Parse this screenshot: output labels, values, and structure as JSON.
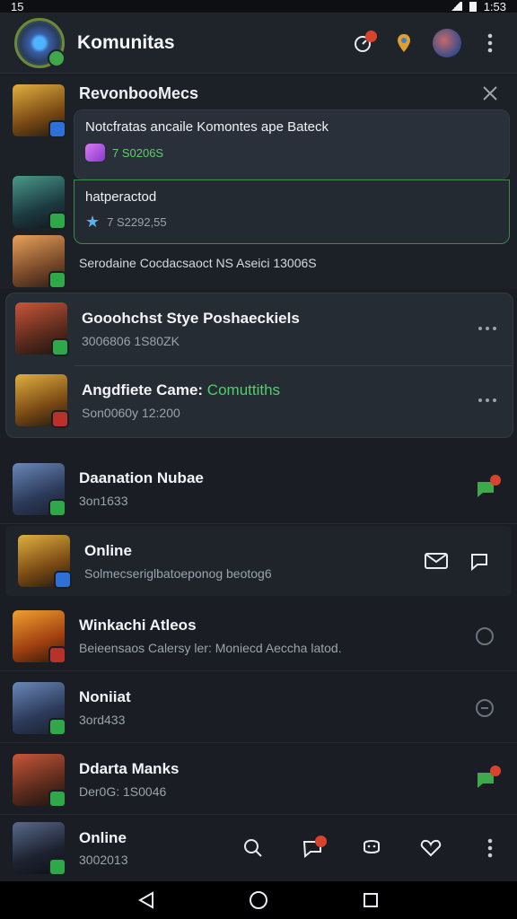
{
  "status_bar": {
    "time": "15",
    "right_text": "1:53"
  },
  "app_bar": {
    "title": "Komunitas"
  },
  "community": {
    "title": "RevonbooMecs",
    "notice": {
      "text": "Notcfratas ancaile Komontes ape Bateck",
      "meta": "7 S0206S"
    },
    "reply": {
      "text": "hatperactod",
      "meta": "7 S2292,55"
    },
    "footer": "Serodaine Cocdacsaoct NS Aseici 13006S"
  },
  "group": {
    "rows": [
      {
        "name": "Gooohchst Stye Poshaeckiels",
        "highlight": "",
        "sub": "3006806 1S80ZK"
      },
      {
        "name": "Angdfiete Came: ",
        "highlight": "Comuttiths",
        "sub": "Son0060y 12:200"
      }
    ]
  },
  "list": [
    {
      "name": "Daanation Nubae",
      "sub": "3on1633"
    },
    {
      "name": "Online",
      "sub": "Solmecseriglbatoeponog beotog6"
    },
    {
      "name": "Winkachi Atleos",
      "sub": "Beieensaos Calersy ler: Moniecd Aeccha latod."
    },
    {
      "name": "Noniiat",
      "sub": "3ord433"
    },
    {
      "name": "Ddarta Manks",
      "sub": "Der0G: 1S0046"
    }
  ],
  "bottom": {
    "name": "Online",
    "sub": "3002013"
  },
  "colors": {
    "accent_green": "#4fcf6a",
    "badge_red": "#d8432e",
    "background": "#1a1e24"
  },
  "icons": [
    "search-icon",
    "chat-icon",
    "mail-icon",
    "heart-icon",
    "more-icon",
    "close-icon"
  ]
}
